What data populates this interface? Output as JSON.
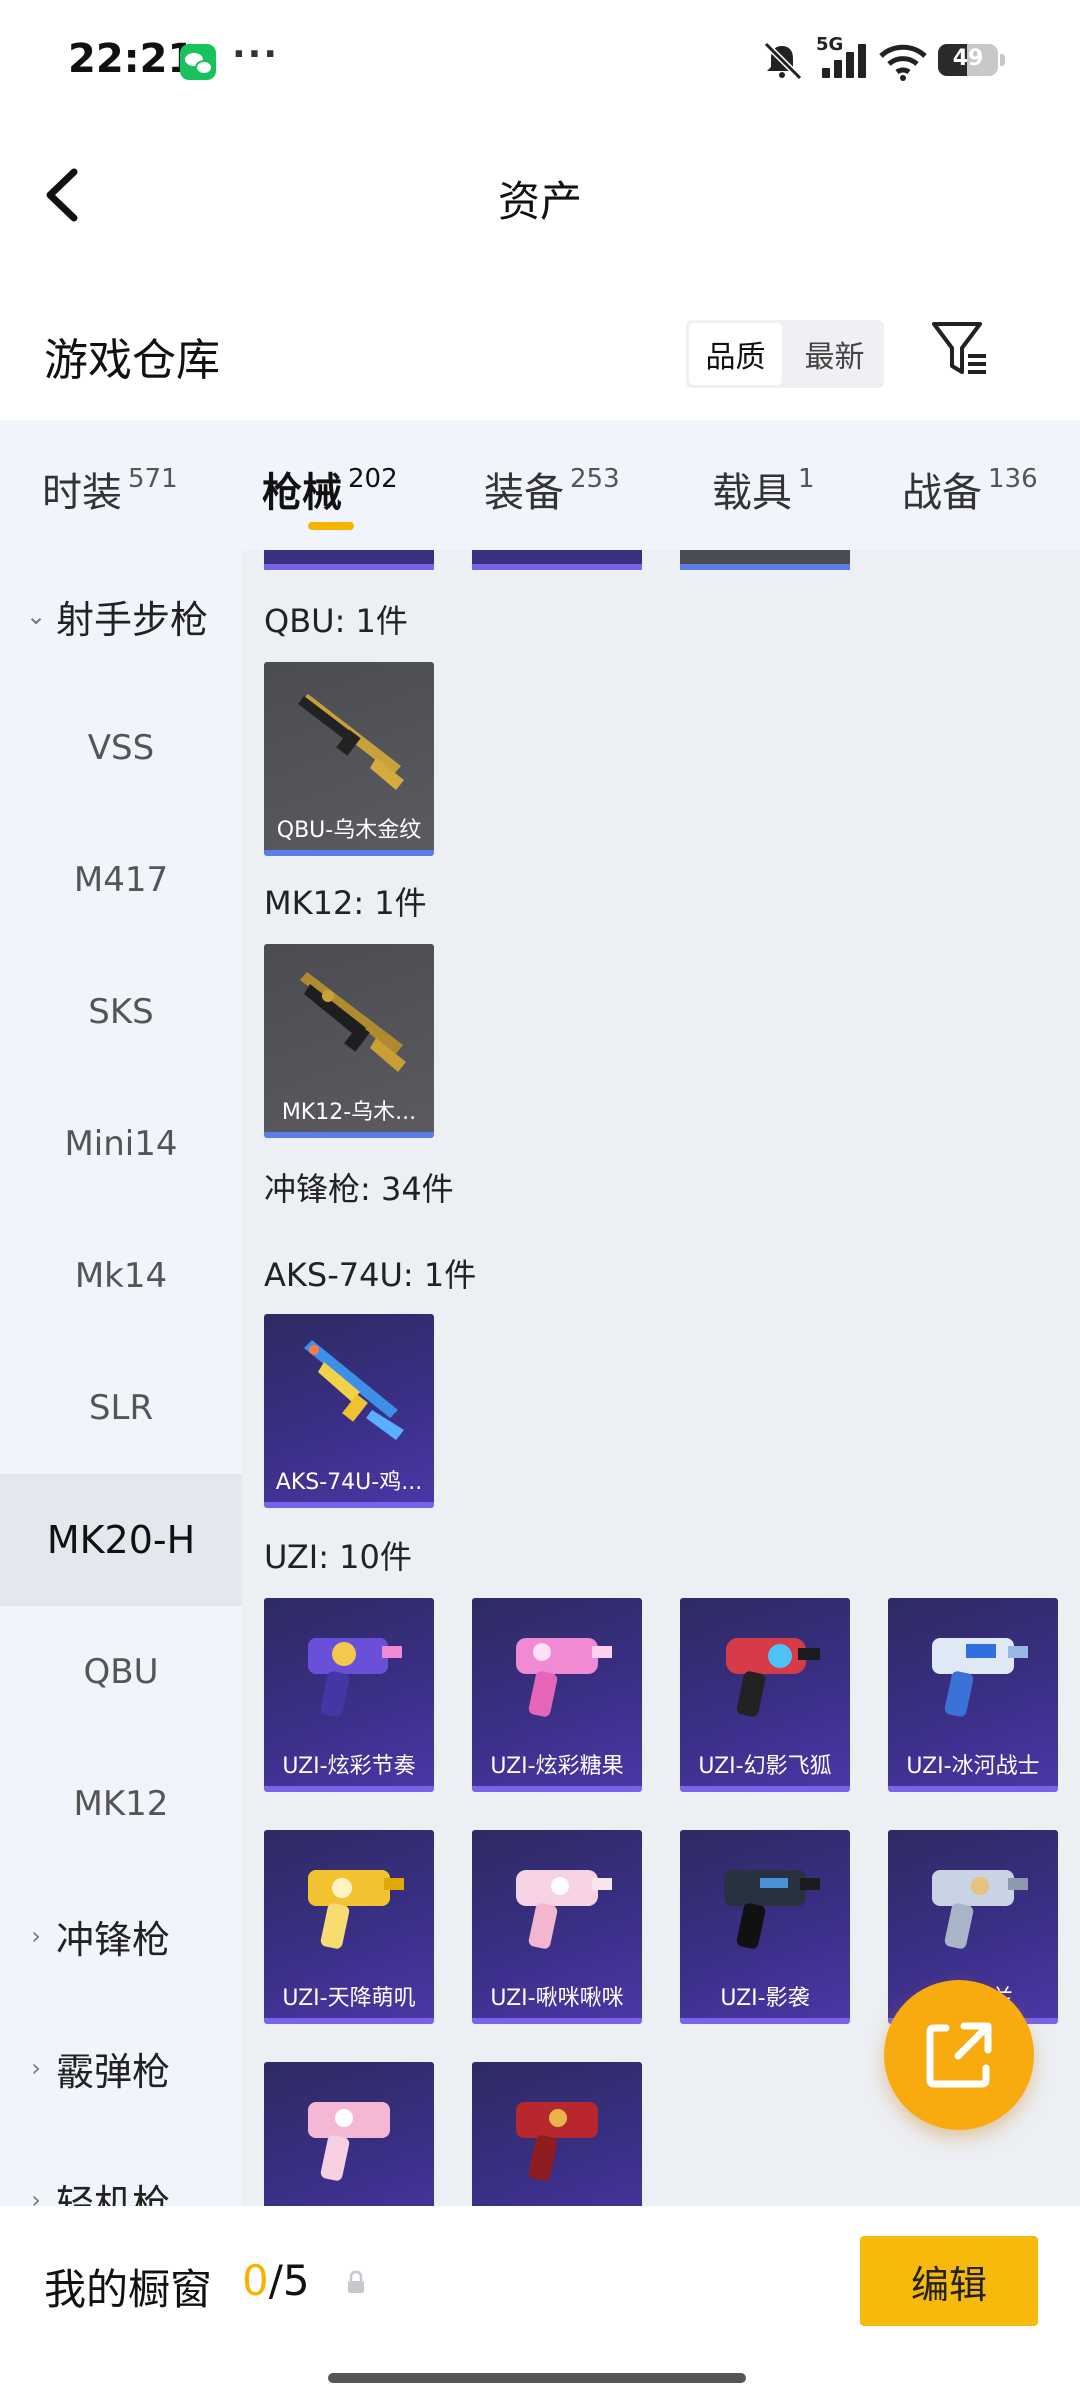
{
  "status_bar": {
    "time": "22:21",
    "network": "5G",
    "battery": "49",
    "battery_level": 0.49
  },
  "header": {
    "title": "资产"
  },
  "warehouse": {
    "title": "游戏仓库",
    "sort_options": [
      "品质",
      "最新"
    ],
    "active_sort": 0
  },
  "tabs": [
    {
      "name": "时装",
      "count": "571"
    },
    {
      "name": "枪械",
      "count": "202",
      "active": true
    },
    {
      "name": "装备",
      "count": "253"
    },
    {
      "name": "载具",
      "count": "1"
    },
    {
      "name": "战备",
      "count": "136"
    }
  ],
  "sidebar": {
    "group_open": "射手步枪",
    "items": [
      "VSS",
      "M417",
      "SKS",
      "Mini14",
      "Mk14",
      "SLR",
      "MK20-H",
      "QBU",
      "MK12"
    ],
    "active_item": "MK20-H",
    "groups_closed": [
      "冲锋枪",
      "霰弹枪",
      "轻机枪"
    ]
  },
  "content": {
    "sections": [
      {
        "label": "QBU: 1件",
        "items": [
          "QBU-乌木金纹"
        ]
      },
      {
        "label": "MK12: 1件",
        "items": [
          "MK12-乌木..."
        ]
      },
      {
        "label": "冲锋枪: 34件"
      },
      {
        "label": "AKS-74U: 1件",
        "items": [
          "AKS-74U-鸡..."
        ]
      },
      {
        "label": "UZI: 10件",
        "items": [
          "UZI-炫彩节奏",
          "UZI-炫彩糖果",
          "UZI-幻影飞狐",
          "UZI-冰河战士",
          "UZI-天降萌叽",
          "UZI-啾咪啾咪",
          "UZI-影袭",
          "U...幽兰"
        ]
      }
    ]
  },
  "bottom_bar": {
    "window_label": "我的橱窗",
    "window_current": "0",
    "window_sep": "/",
    "window_max": "5",
    "edit_label": "编辑"
  },
  "colors": {
    "accent": "#f7b90c",
    "tab_bg": "#f1f5fb",
    "content_bg": "#eceff4",
    "card_purple": "#3a2f86",
    "card_gray": "#55565c"
  }
}
